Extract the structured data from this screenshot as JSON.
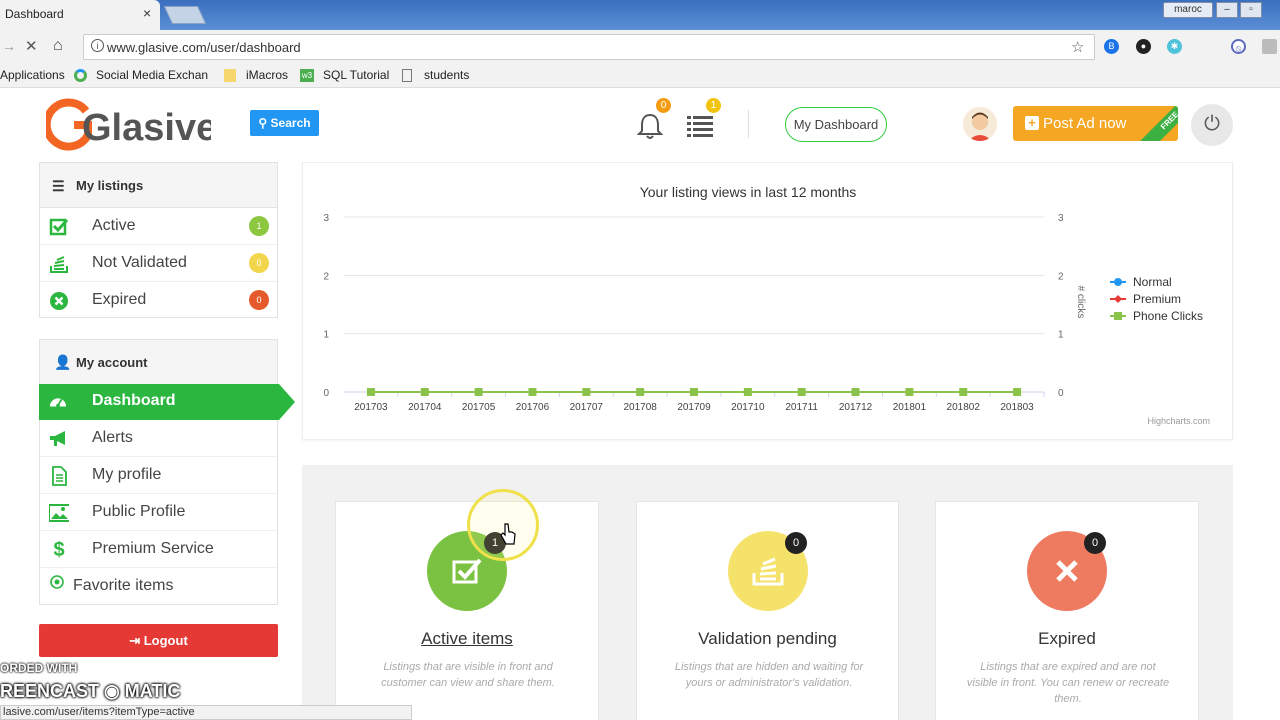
{
  "browser": {
    "tab_title": "Dashboard",
    "tab_close": "×",
    "user_badge": "maroc",
    "url": "www.glasive.com/user/dashboard",
    "bookmarks": [
      "Applications",
      "Social Media Exchanc",
      "iMacros",
      "SQL Tutorial",
      "students"
    ],
    "status_url": "lasive.com/user/items?itemType=active"
  },
  "header": {
    "logo_text": "Glasive",
    "search_label": "Search",
    "notifications_count": "0",
    "messages_count": "1",
    "my_dashboard_label": "My Dashboard",
    "post_ad_label": "Post Ad now",
    "free_ribbon": "FREE"
  },
  "sidebar": {
    "listings_title": "My listings",
    "listings": [
      {
        "label": "Active",
        "count": "1",
        "color": "#8dc63f"
      },
      {
        "label": "Not Validated",
        "count": "0",
        "color": "#f1d54a"
      },
      {
        "label": "Expired",
        "count": "0",
        "color": "#e55a2b"
      }
    ],
    "account_title": "My account",
    "account_items": [
      {
        "label": "Dashboard",
        "active": true
      },
      {
        "label": "Alerts"
      },
      {
        "label": "My profile"
      },
      {
        "label": "Public Profile"
      },
      {
        "label": "Premium Service"
      },
      {
        "label": "Favorite items"
      }
    ],
    "logout_label": "Logout"
  },
  "chart_data": {
    "type": "line",
    "title": "Your listing views in last 12 months",
    "categories": [
      "201703",
      "201704",
      "201705",
      "201706",
      "201707",
      "201708",
      "201709",
      "201710",
      "201711",
      "201712",
      "201801",
      "201802",
      "201803"
    ],
    "series": [
      {
        "name": "Normal",
        "color": "#2196f3",
        "values": [
          0,
          0,
          0,
          0,
          0,
          0,
          0,
          0,
          0,
          0,
          0,
          0,
          0
        ]
      },
      {
        "name": "Premium",
        "color": "#e53935",
        "values": [
          0,
          0,
          0,
          0,
          0,
          0,
          0,
          0,
          0,
          0,
          0,
          0,
          0
        ]
      },
      {
        "name": "Phone Clicks",
        "color": "#8bc34a",
        "values": [
          0,
          0,
          0,
          0,
          0,
          0,
          0,
          0,
          0,
          0,
          0,
          0,
          0
        ]
      }
    ],
    "ylim": [
      0,
      3
    ],
    "yticks": [
      "0",
      "1",
      "2",
      "3"
    ],
    "y2label": "# clicks",
    "credit": "Highcharts.com",
    "legend": "right"
  },
  "cards": [
    {
      "title": "Active items",
      "count": "1",
      "color": "#7cc242",
      "icon": "check-square-icon",
      "desc": "Listings that are visible in front and customer can view and share them."
    },
    {
      "title": "Validation pending",
      "count": "0",
      "color": "#f4e26b",
      "icon": "stack-icon",
      "desc": "Listings that are hidden and waiting for yours or administrator's validation."
    },
    {
      "title": "Expired",
      "count": "0",
      "color": "#ee7a5f",
      "icon": "close-icon",
      "desc": "Listings that are expired and are not visible in front. You can renew or recreate them."
    }
  ],
  "watermark": {
    "top": "ORDED WITH",
    "bottom": "REENCAST ◉ MATIC"
  }
}
